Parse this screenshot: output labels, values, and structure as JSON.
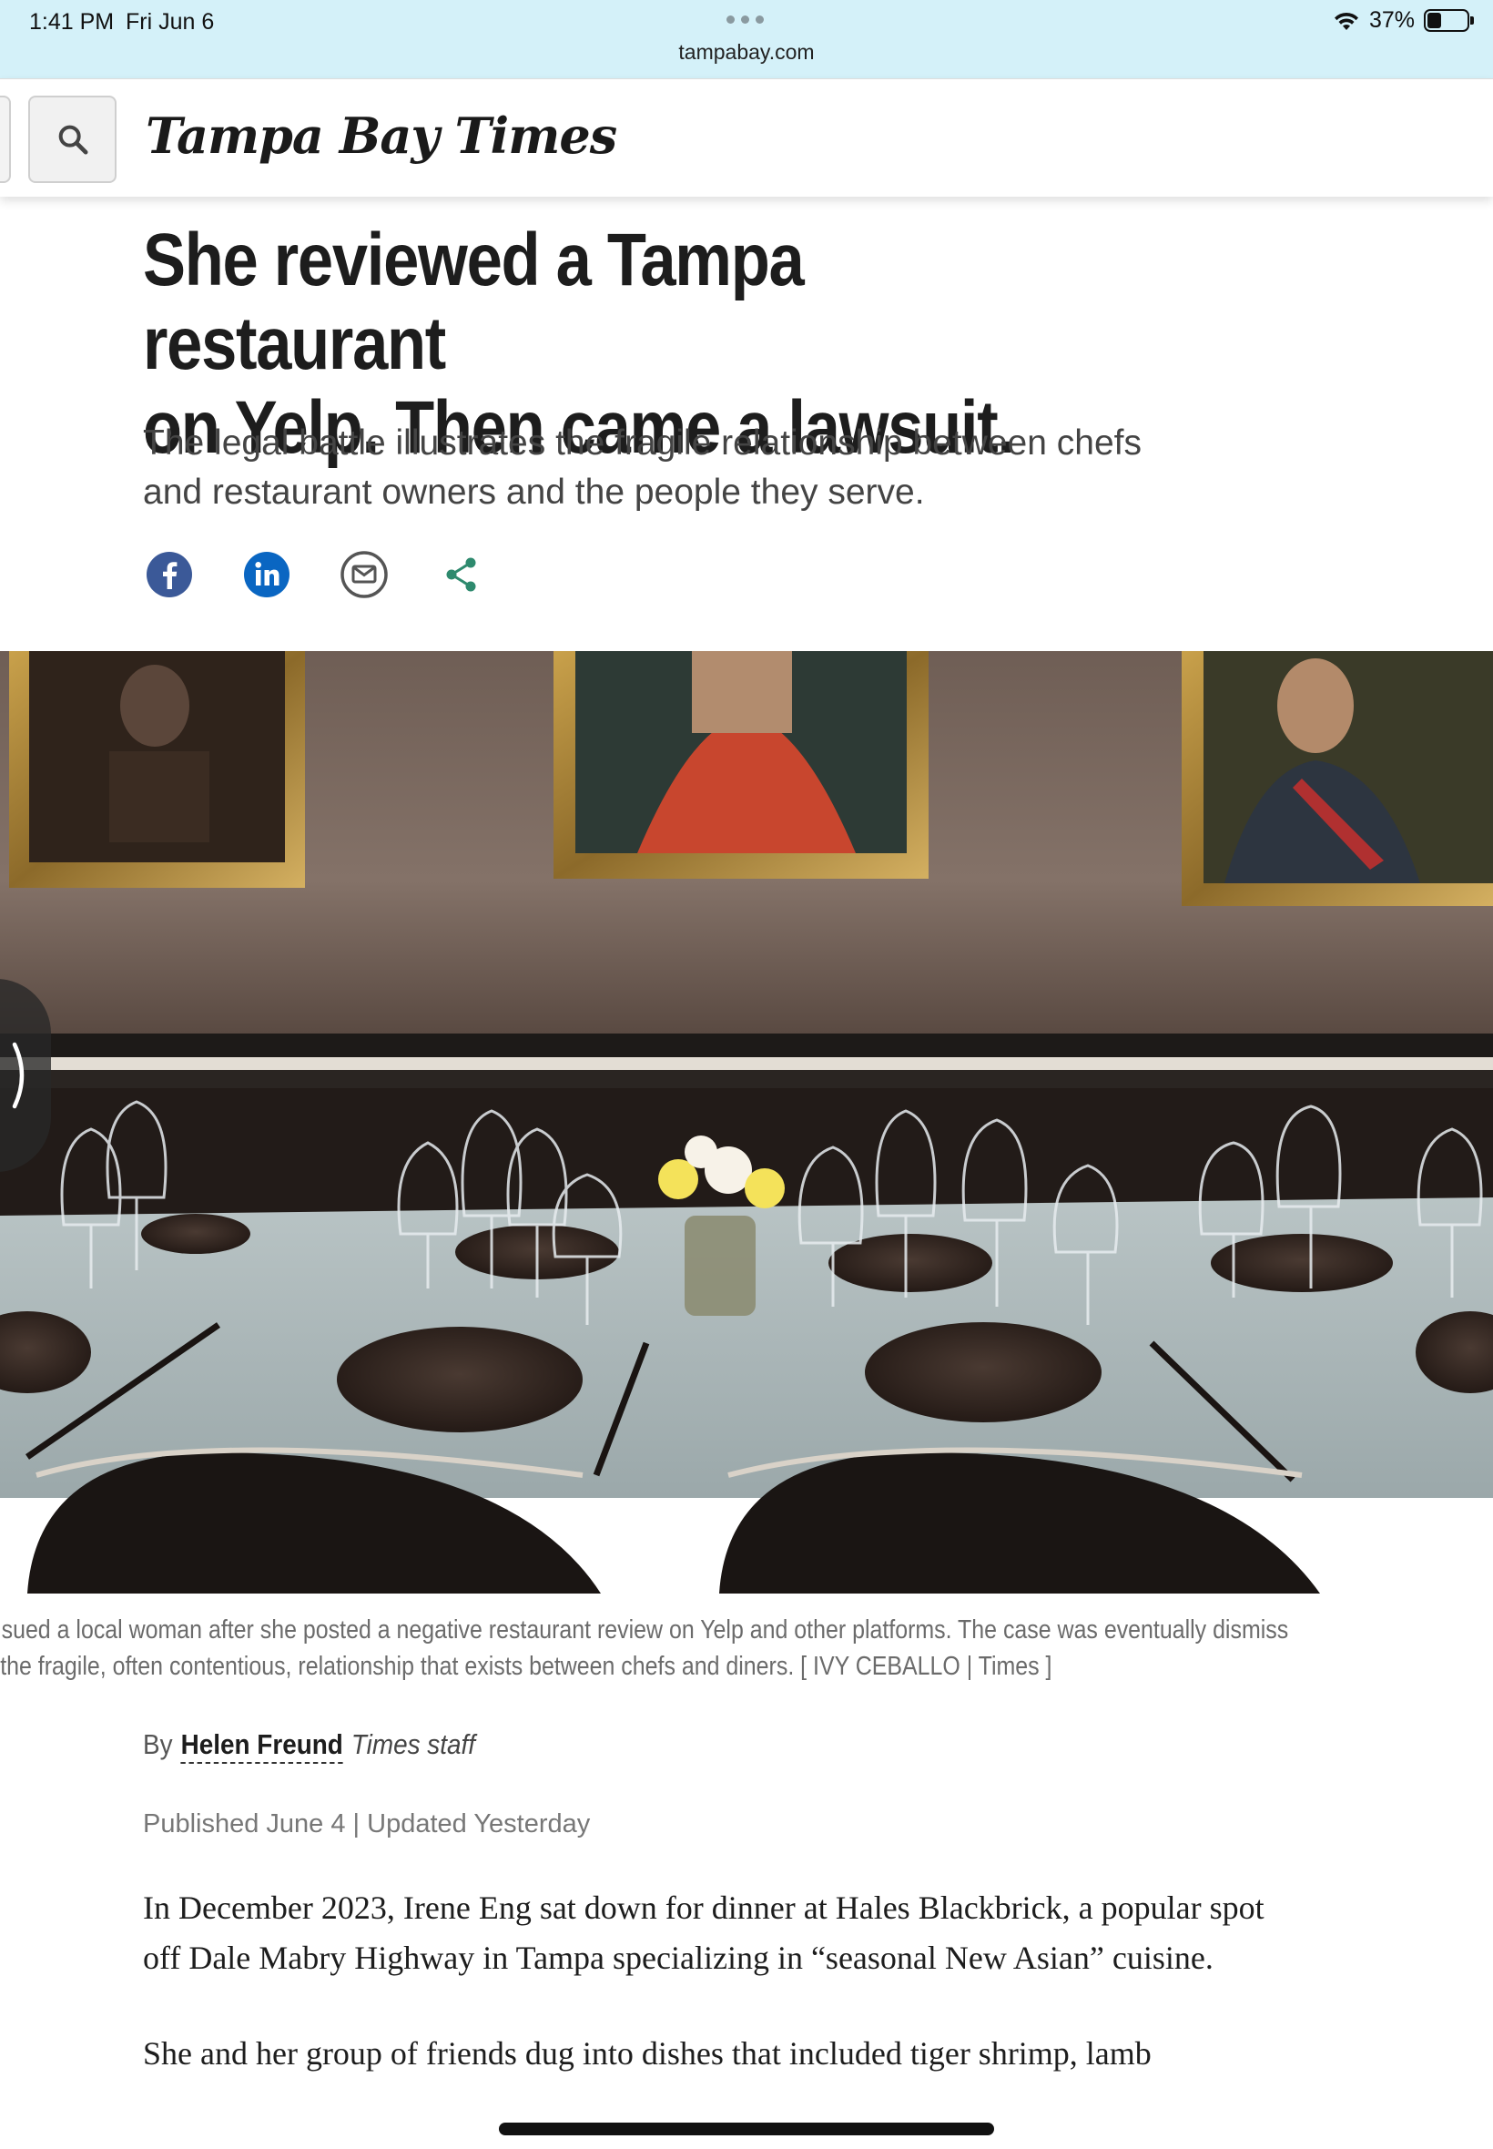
{
  "status_bar": {
    "time": "1:41 PM",
    "date": "Fri Jun 6",
    "url": "tampabay.com",
    "battery": "37%",
    "battery_level": 0.37
  },
  "header": {
    "logo_text": "Tampa Bay Times",
    "search_icon": "search-icon"
  },
  "article": {
    "headline_line1": "She reviewed a Tampa restaurant",
    "headline_line2": "on Yelp. Then came a lawsuit.",
    "subhead": "The legal battle illustrates the fragile relationship between chefs and restaurant owners and the people they serve.",
    "share": [
      {
        "name": "facebook-icon",
        "color": "#3b5998"
      },
      {
        "name": "linkedin-icon",
        "color": "#0a66c2"
      },
      {
        "name": "email-icon",
        "color": "#555555"
      },
      {
        "name": "share-icon",
        "color": "#2e8a6e"
      }
    ],
    "caption_line1": "hef sued a local woman after she posted a negative restaurant review on Yelp and other platforms. The case was eventually dismiss",
    "caption_line2": "tes the fragile, often contentious, relationship that exists between chefs and diners. [ IVY CEBALLO | Times ]",
    "byline_prefix": "By",
    "author": "Helen Freund",
    "author_role": "Times staff",
    "published": "Published June 4 | Updated Yesterday",
    "paragraphs": [
      "In December 2023, Irene Eng sat down for dinner at Hales Blackbrick, a popular spot off Dale Mabry Highway in Tampa specializing in “seasonal New Asian” cuisine.",
      "She and her group of friends dug into dishes that included tiger shrimp, lamb"
    ]
  }
}
